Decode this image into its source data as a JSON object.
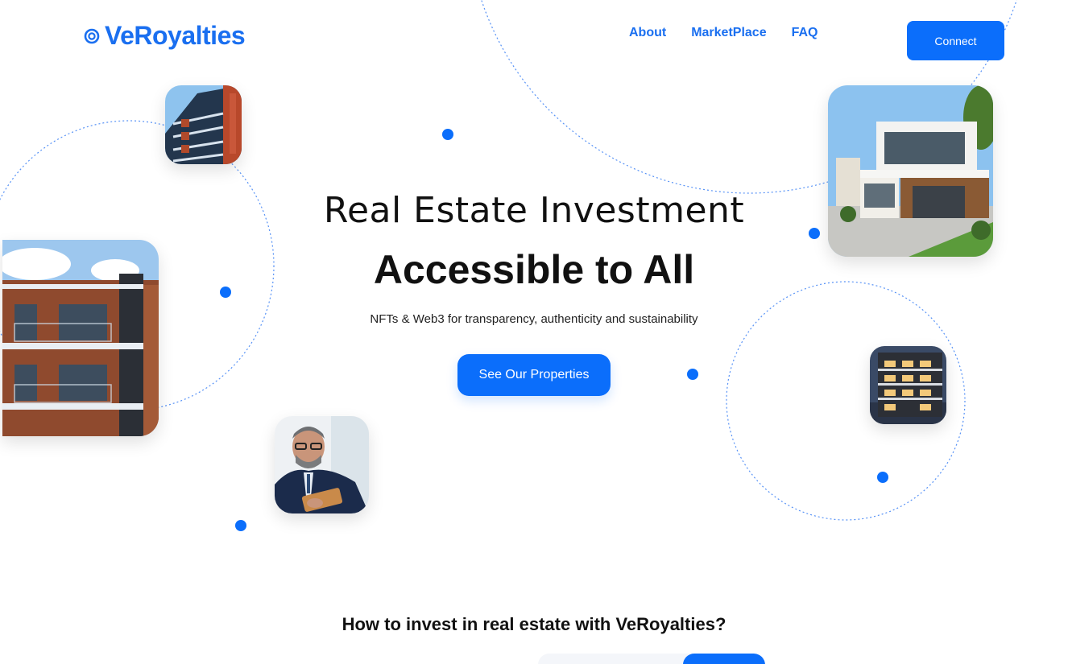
{
  "brand": {
    "name": "VeRoyalties",
    "logo_icon": "ring-logo-icon",
    "color": "#1a6ff0"
  },
  "nav": {
    "items": [
      {
        "label": "About"
      },
      {
        "label": "MarketPlace"
      },
      {
        "label": "FAQ"
      }
    ],
    "connect_label": "Connect"
  },
  "hero": {
    "title": "Real Estate Investment",
    "subtitle": "Accessible to All",
    "description": "NFTs & Web3 for transparency, authenticity and sustainability",
    "cta_label": "See Our Properties"
  },
  "images": [
    {
      "name": "apartment-balconies-photo"
    },
    {
      "name": "brick-apartment-building-photo"
    },
    {
      "name": "businessman-with-tablet-photo"
    },
    {
      "name": "modern-house-photo"
    },
    {
      "name": "night-apartment-building-photo"
    }
  ],
  "how_to": {
    "title": "How to invest in real estate with VeRoyalties?"
  },
  "colors": {
    "accent": "#0b6efb",
    "text": "#111111",
    "background": "#ffffff"
  }
}
